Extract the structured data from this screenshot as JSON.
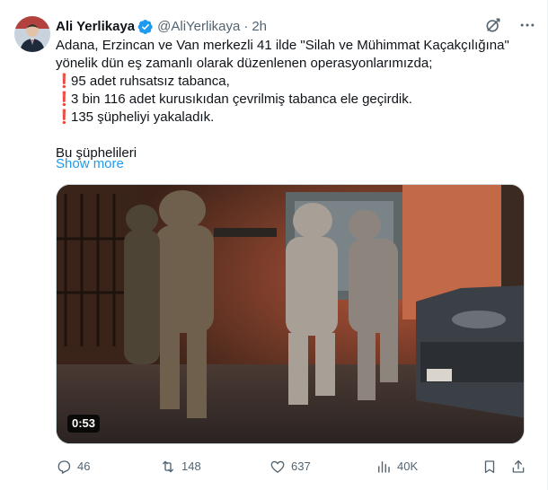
{
  "author": {
    "display_name": "Ali Yerlikaya",
    "handle": "@AliYerlikaya",
    "separator": "·",
    "time": "2h"
  },
  "tweet": {
    "line1": "Adana, Erzincan ve Van merkezli 41 ilde \"Silah ve Mühimmat Kaçakçılığına\"",
    "line2": "yönelik dün eş zamanlı olarak düzenlenen operasyonlarımızda;",
    "bullet_mark": "❗",
    "bullets": [
      "95 adet ruhsatsız tabanca,",
      "3 bin 116 adet kurusıkıdan çevrilmiş tabanca ele geçirdik.",
      "135 şüpheliyi yakaladık."
    ],
    "line_after": "Bu şüphelileri",
    "show_more": "Show more"
  },
  "media": {
    "type": "video",
    "duration": "0:53"
  },
  "actions": {
    "replies": "46",
    "reposts": "148",
    "likes": "637",
    "views": "40K"
  },
  "icons": {
    "verified": "verified-badge-icon",
    "grok": "grok-icon",
    "more": "more-icon",
    "reply": "reply-icon",
    "repost": "repost-icon",
    "like": "heart-icon",
    "views": "views-icon",
    "bookmark": "bookmark-icon",
    "share": "share-icon"
  },
  "colors": {
    "accent": "#1d9bf0",
    "text": "#0f1419",
    "muted": "#536471",
    "bullet": "#e0245e"
  }
}
